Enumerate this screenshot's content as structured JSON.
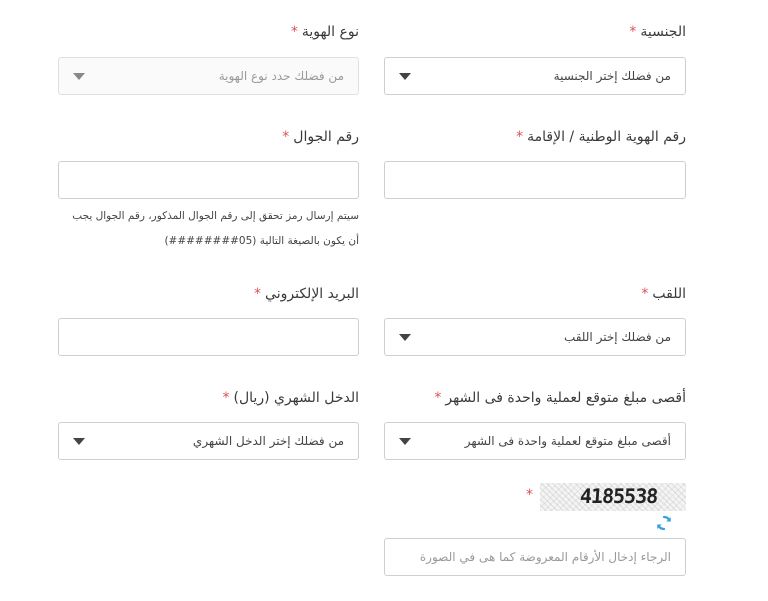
{
  "required_mark": "*",
  "nationality": {
    "label": "الجنسية",
    "selected": "من فضلك إختر الجنسية"
  },
  "id_type": {
    "label": "نوع الهوية",
    "selected": "من فضلك حدد نوع الهوية"
  },
  "national_id": {
    "label": "رقم الهوية الوطنية / الإقامة",
    "value": ""
  },
  "mobile": {
    "label": "رقم الجوال",
    "value": "",
    "hint_line1": "سيتم إرسال رمز تحقق إلى رقم الجوال المذكور، رقم الجوال يجب",
    "hint_line2": "أن يكون بالصيغة التالية  (05########)"
  },
  "title": {
    "label": "اللقب",
    "selected": "من فضلك إختر اللقب"
  },
  "email": {
    "label": "البريد الإلكتروني",
    "value": ""
  },
  "max_amount": {
    "label": "أقصى مبلغ متوقع لعملية واحدة فى الشهر",
    "selected": "أقصى مبلغ متوقع لعملية واحدة فى الشهر"
  },
  "monthly_income": {
    "label": "الدخل الشهري (ريال)",
    "selected": "من فضلك إختر الدخل الشهري"
  },
  "captcha": {
    "code": "4185538",
    "input_placeholder": "الرجاء إدخال الأرقام المعروضة كما هى في الصورة",
    "refresh_icon": "refresh-icon"
  },
  "colors": {
    "required": "#d9534f",
    "refresh": "#3aa0dc",
    "border": "#cfcfcf"
  }
}
